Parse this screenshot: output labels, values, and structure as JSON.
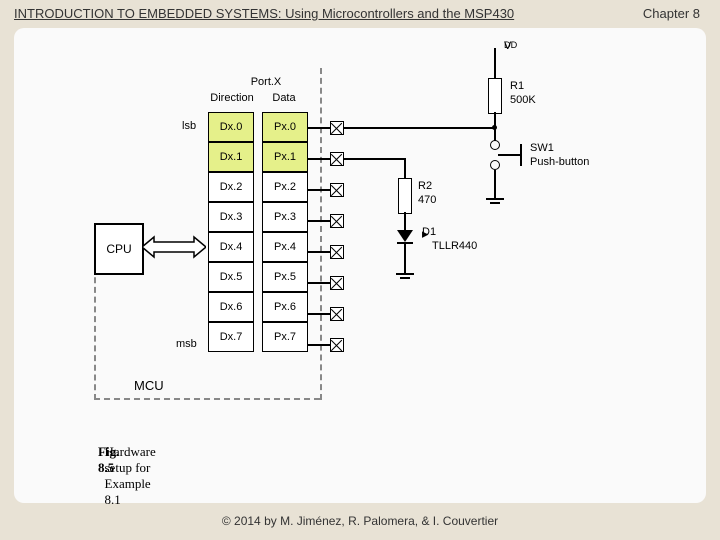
{
  "header": {
    "title": "INTRODUCTION TO EMBEDDED SYSTEMS: Using Microcontrollers and the MSP430",
    "chapter": "Chapter 8"
  },
  "copyright": "© 2014 by M. Jiménez, R. Palomera, & I. Couvertier",
  "diagram": {
    "cpu": "CPU",
    "port_header_top": "Port.X",
    "col_dir": "Direction",
    "col_data": "Data",
    "lsb": "lsb",
    "msb": "msb",
    "mcu": "MCU",
    "dir": [
      "Dx.0",
      "Dx.1",
      "Dx.2",
      "Dx.3",
      "Dx.4",
      "Dx.5",
      "Dx.6",
      "Dx.7"
    ],
    "data": [
      "Px.0",
      "Px.1",
      "Px.2",
      "Px.3",
      "Px.4",
      "Px.5",
      "Px.6",
      "Px.7"
    ],
    "vdd": "V",
    "vdd_sub": "DD",
    "r1": "R1",
    "r1_val": "500K",
    "sw1": "SW1",
    "sw1_desc": "Push-button",
    "r2": "R2",
    "r2_val": "470",
    "d1": "D1",
    "d1_part": "TLLR440",
    "caption_bold": "Fig. 8.5",
    "caption_rest": "Hardware setup for Example 8.1"
  }
}
